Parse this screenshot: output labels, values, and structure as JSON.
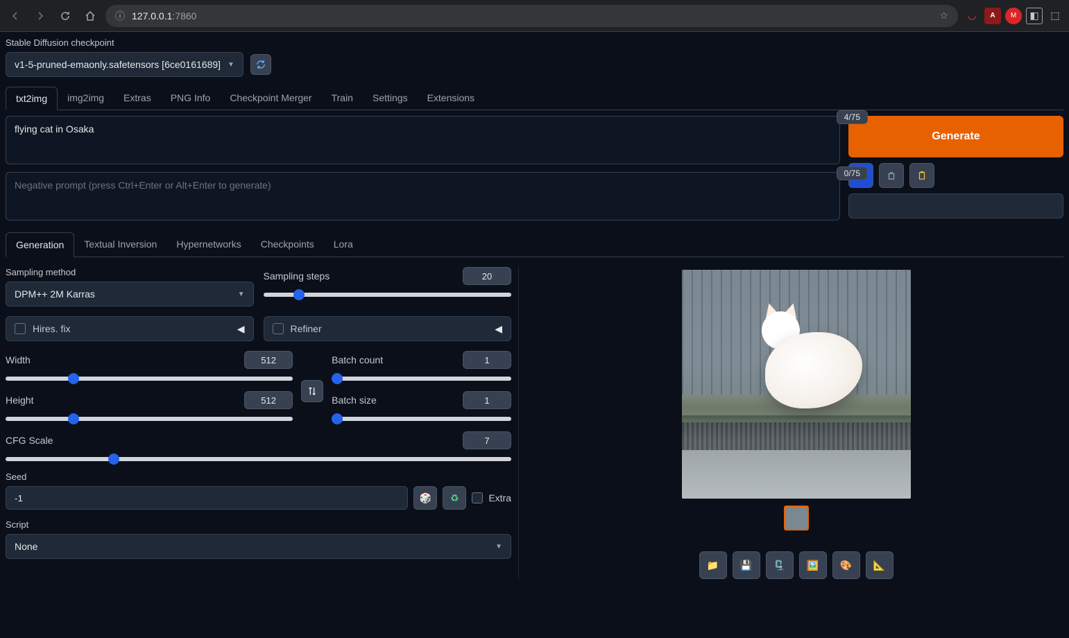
{
  "browser": {
    "url_host": "127.0.0.1",
    "url_port": ":7860"
  },
  "checkpoint": {
    "label": "Stable Diffusion checkpoint",
    "selected": "v1-5-pruned-emaonly.safetensors [6ce0161689]"
  },
  "tabs": [
    "txt2img",
    "img2img",
    "Extras",
    "PNG Info",
    "Checkpoint Merger",
    "Train",
    "Settings",
    "Extensions"
  ],
  "prompt": {
    "value": "flying cat in Osaka",
    "tokens": "4/75"
  },
  "neg_prompt": {
    "placeholder": "Negative prompt (press Ctrl+Enter or Alt+Enter to generate)",
    "tokens": "0/75"
  },
  "generate_label": "Generate",
  "subtabs": [
    "Generation",
    "Textual Inversion",
    "Hypernetworks",
    "Checkpoints",
    "Lora"
  ],
  "sampling": {
    "method_label": "Sampling method",
    "method_value": "DPM++ 2M Karras",
    "steps_label": "Sampling steps",
    "steps_value": "20"
  },
  "hires_label": "Hires. fix",
  "refiner_label": "Refiner",
  "dims": {
    "width_label": "Width",
    "width_value": "512",
    "height_label": "Height",
    "height_value": "512"
  },
  "batch": {
    "count_label": "Batch count",
    "count_value": "1",
    "size_label": "Batch size",
    "size_value": "1"
  },
  "cfg": {
    "label": "CFG Scale",
    "value": "7"
  },
  "seed": {
    "label": "Seed",
    "value": "-1",
    "extra_label": "Extra"
  },
  "script": {
    "label": "Script",
    "value": "None"
  }
}
